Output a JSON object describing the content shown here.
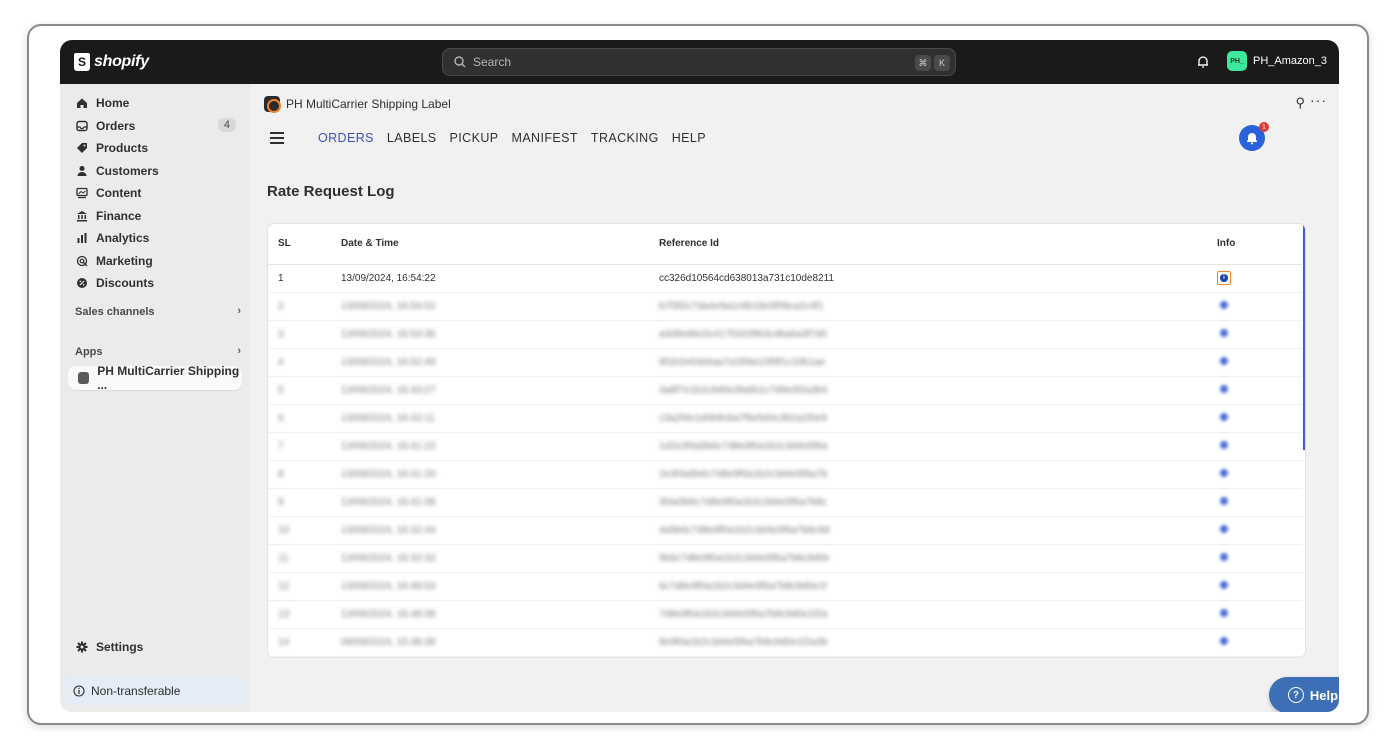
{
  "topbar": {
    "brand": "shopify",
    "search_placeholder": "Search",
    "kbd_cmd": "⌘",
    "kbd_k": "K",
    "store_initials": "PH_",
    "store_name": "PH_Amazon_3"
  },
  "sidebar": {
    "items": [
      {
        "label": "Home",
        "icon": "home-icon"
      },
      {
        "label": "Orders",
        "icon": "inbox-icon",
        "count": "4"
      },
      {
        "label": "Products",
        "icon": "tag-icon"
      },
      {
        "label": "Customers",
        "icon": "person-icon"
      },
      {
        "label": "Content",
        "icon": "content-icon"
      },
      {
        "label": "Finance",
        "icon": "bank-icon"
      },
      {
        "label": "Analytics",
        "icon": "bar-chart-icon"
      },
      {
        "label": "Marketing",
        "icon": "target-icon"
      },
      {
        "label": "Discounts",
        "icon": "discount-icon"
      }
    ],
    "sales_channels": "Sales channels",
    "apps": "Apps",
    "app_item": "PH MultiCarrier Shipping ...",
    "settings": "Settings",
    "non_transferable": "Non-transferable"
  },
  "main": {
    "app_title": "PH MultiCarrier Shipping Label",
    "tabs": [
      "ORDERS",
      "LABELS",
      "PICKUP",
      "MANIFEST",
      "TRACKING",
      "HELP"
    ],
    "active_tab": "ORDERS",
    "notification_count": "1",
    "page_title": "Rate Request Log",
    "table": {
      "headers": [
        "SL",
        "Date & Time",
        "Reference Id",
        "Info"
      ],
      "first_row": {
        "sl": "1",
        "datetime": "13/09/2024, 16:54:22",
        "reference": "cc326d10564cd638013a731c10de8211"
      },
      "blurred_rows": [
        {
          "sl": "2",
          "datetime": "13/09/2024, 16:54:02",
          "reference": "b7f3f2c7da4e9a1c6b18e5f09ca2c4f1"
        },
        {
          "sl": "3",
          "datetime": "13/09/2024, 16:53:36",
          "reference": "a3d9e6bc0c417f2d1f9b3c4ba6a3f7d0"
        },
        {
          "sl": "4",
          "datetime": "13/09/2024, 16:52:49",
          "reference": "9f1b2e63d4aa7a1f0be23f9f1c33b1ae"
        },
        {
          "sl": "5",
          "datetime": "13/09/2024, 16:43:27",
          "reference": "4a8f7e1b2c9d0e3fa6b1c7d9e0f2a3b4"
        },
        {
          "sl": "6",
          "datetime": "13/09/2024, 16:42:11",
          "reference": "c3a2f4e1d0b9c8a7f6e5d4c3b2a1f0e9"
        },
        {
          "sl": "7",
          "datetime": "13/09/2024, 16:41:22",
          "reference": "1d2e3f4a5b6c7d8e9f0a1b2c3d4e5f6a"
        },
        {
          "sl": "8",
          "datetime": "13/09/2024, 16:41:20",
          "reference": "2e3f4a5b6c7d8e9f0a1b2c3d4e5f6a7b"
        },
        {
          "sl": "9",
          "datetime": "13/09/2024, 16:41:08",
          "reference": "3f4a5b6c7d8e9f0a1b2c3d4e5f6a7b8c"
        },
        {
          "sl": "10",
          "datetime": "13/09/2024, 16:32:44",
          "reference": "4a5b6c7d8e9f0a1b2c3d4e5f6a7b8c9d"
        },
        {
          "sl": "11",
          "datetime": "13/09/2024, 16:32:32",
          "reference": "5b6c7d8e9f0a1b2c3d4e5f6a7b8c9d0e"
        },
        {
          "sl": "12",
          "datetime": "13/09/2024, 16:48:53",
          "reference": "6c7d8e9f0a1b2c3d4e5f6a7b8c9d0e1f"
        },
        {
          "sl": "13",
          "datetime": "13/09/2024, 16:48:39",
          "reference": "7d8e9f0a1b2c3d4e5f6a7b8c9d0e1f2a"
        },
        {
          "sl": "14",
          "datetime": "09/09/2024, 15:38:38",
          "reference": "8e9f0a1b2c3d4e5f6a7b8c9d0e1f2a3b"
        }
      ]
    },
    "help_label": "Help"
  },
  "colors": {
    "active_tab": "#3f51b5",
    "help_button": "#3d6fb6",
    "notification": "#2962d9",
    "highlight": "#f0832a"
  }
}
